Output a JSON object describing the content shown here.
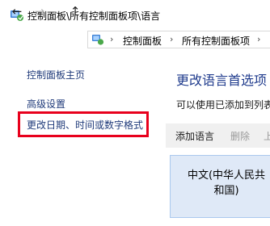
{
  "window": {
    "title": "控制面板\\所有控制面板项\\语言"
  },
  "navigation": {
    "back_icon": "←",
    "forward_icon": "→",
    "dropdown_icon": "⌄",
    "up_icon": "↑",
    "breadcrumb": [
      {
        "label": "控制面板"
      },
      {
        "label": "所有控制面板项"
      }
    ],
    "separator": "›"
  },
  "sidebar": {
    "items": [
      {
        "label": "控制面板主页"
      },
      {
        "label": "高级设置"
      },
      {
        "label": "更改日期、时间或数字格式"
      }
    ]
  },
  "main": {
    "heading": "更改语言首选项",
    "description": "可以使用已添加到列表",
    "toolbar": {
      "add_label": "添加语言",
      "delete_label": "删除",
      "up_label": "上"
    },
    "languages": [
      {
        "line1": "中文(中华人民共",
        "line2": "和国)"
      }
    ]
  },
  "colors": {
    "accent": "#1e3a8c",
    "link": "#1f3a7a",
    "highlight": "#e8001c",
    "tile_bg": "#dfe9f7"
  }
}
